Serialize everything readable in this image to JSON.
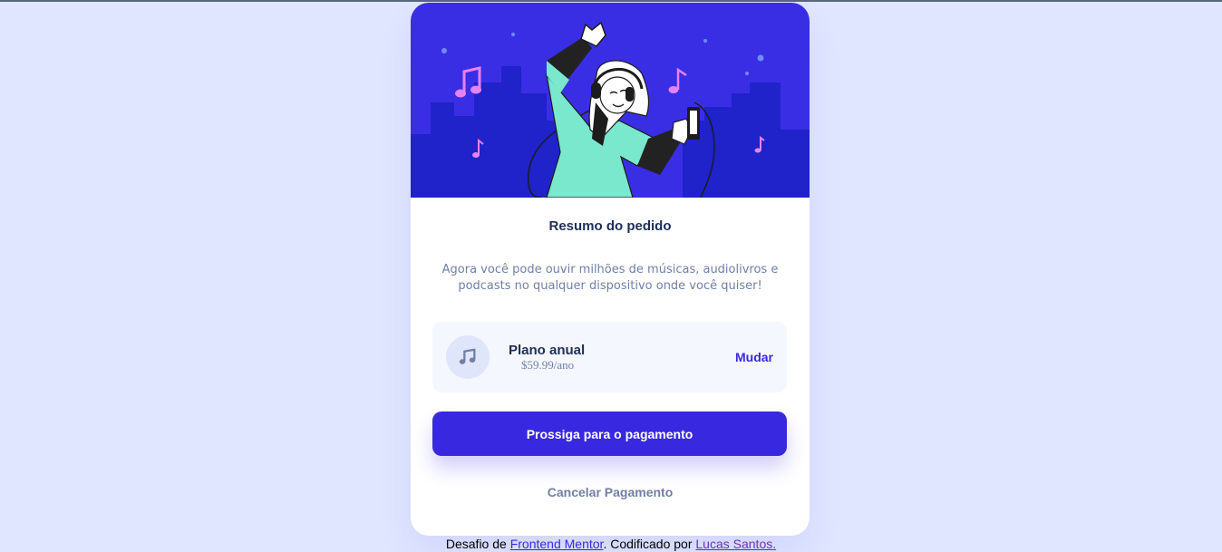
{
  "card": {
    "title": "Resumo do pedido",
    "description": "Agora você pode ouvir milhões de músicas, audiolivros e podcasts no qualquer dispositivo onde você quiser!",
    "hero_icon": "person-dancing-with-headphones-illustration"
  },
  "plan": {
    "icon": "music-note-icon",
    "name": "Plano anual",
    "price": "$59.99/ano",
    "change_label": "Mudar"
  },
  "actions": {
    "pay_label": "Prossiga para o pagamento",
    "cancel_label": "Cancelar Pagamento"
  },
  "attribution": {
    "prefix": "Desafio de ",
    "mentor_link": "Frontend Mentor",
    "middle": ". Codificado por ",
    "author_link": "Lucas Santos."
  },
  "colors": {
    "background": "#e0e6ff",
    "accent": "#3829e0",
    "hero": "#3a2ee4",
    "title": "#1f2f56",
    "muted": "#717fa6"
  }
}
